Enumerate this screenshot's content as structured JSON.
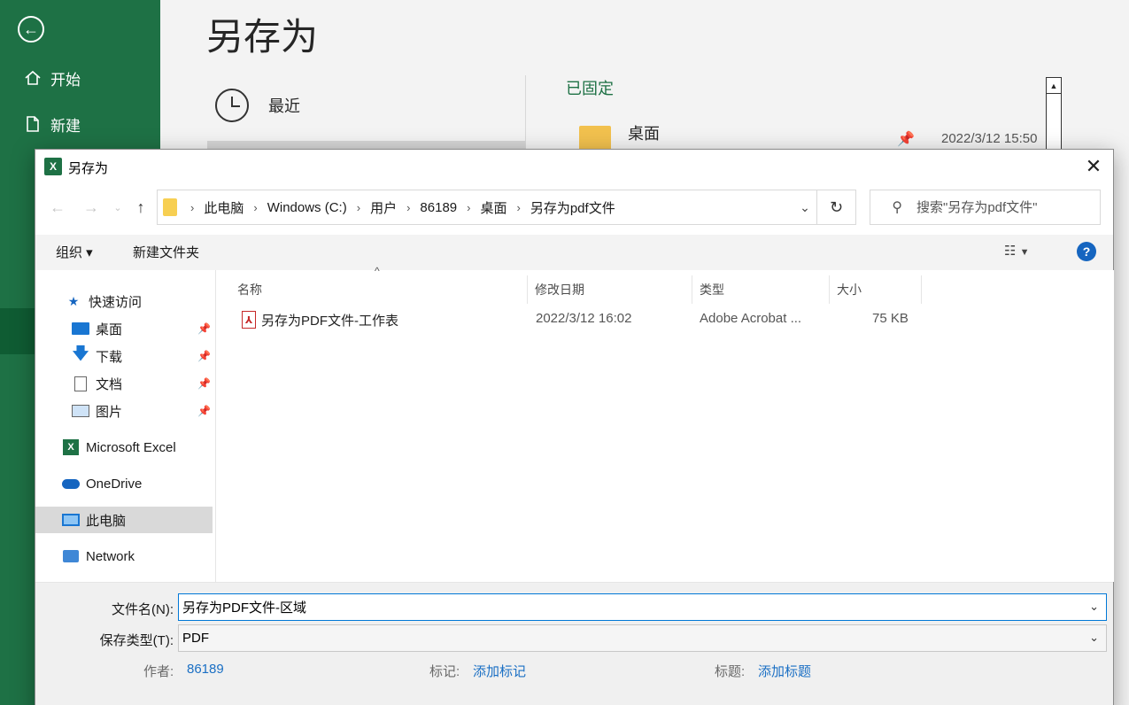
{
  "backstage": {
    "title": "另存为",
    "nav": [
      {
        "label": "开始"
      },
      {
        "label": "新建"
      }
    ],
    "recent_label": "最近",
    "pinned_label": "已固定",
    "pinned_item": {
      "name": "桌面",
      "date": "2022/3/12 15:50"
    }
  },
  "dialog": {
    "title": "另存为",
    "breadcrumb": [
      "此电脑",
      "Windows (C:)",
      "用户",
      "86189",
      "桌面",
      "另存为pdf文件"
    ],
    "search_placeholder": "搜索\"另存为pdf文件\"",
    "toolbar": {
      "organize": "组织 ▾",
      "new_folder": "新建文件夹",
      "help": "?"
    },
    "nav_pane": {
      "quick_access": "快速访问",
      "quick_items": [
        {
          "label": "桌面",
          "icon": "desktop-icon"
        },
        {
          "label": "下载",
          "icon": "download-icon"
        },
        {
          "label": "文档",
          "icon": "document-icon"
        },
        {
          "label": "图片",
          "icon": "pictures-icon"
        }
      ],
      "excel": "Microsoft Excel",
      "onedrive": "OneDrive",
      "this_pc": "此电脑",
      "network": "Network"
    },
    "columns": {
      "name": "名称",
      "modified": "修改日期",
      "type": "类型",
      "size": "大小"
    },
    "files": [
      {
        "name": "另存为PDF文件-工作表",
        "modified": "2022/3/12 16:02",
        "type": "Adobe Acrobat ...",
        "size": "75 KB"
      }
    ],
    "filename_label": "文件名(N):",
    "filename_value": "另存为PDF文件-区域",
    "filetype_label": "保存类型(T):",
    "filetype_value": "PDF",
    "meta": {
      "author_label": "作者:",
      "author_value": "86189",
      "tags_label": "标记:",
      "tags_value": "添加标记",
      "subject_label": "标题:",
      "subject_value": "添加标题"
    }
  },
  "colors": {
    "excel_green": "#1e7145",
    "link_blue": "#1a6fc4",
    "focus_blue": "#0078d7"
  }
}
